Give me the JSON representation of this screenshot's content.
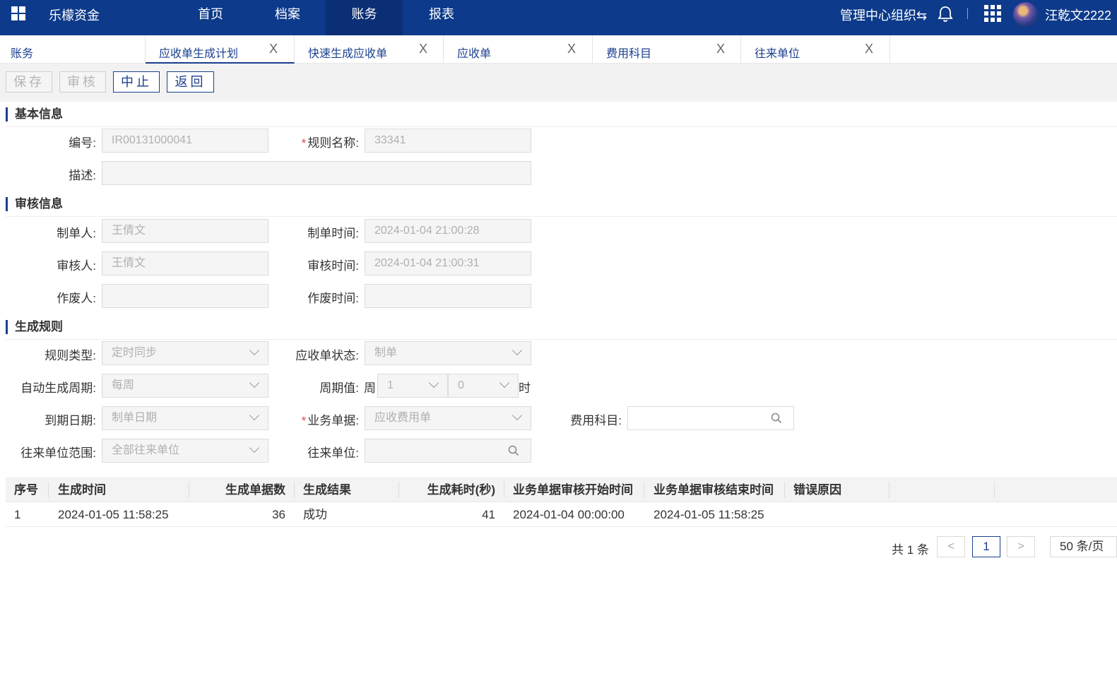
{
  "topbar": {
    "app_name": "乐檬资金",
    "nav": [
      "首页",
      "档案",
      "账务",
      "报表"
    ],
    "active_nav": "账务",
    "org": "管理中心组织",
    "org_switch_icon": "⇆",
    "user": "汪乾文2222"
  },
  "tabs": {
    "home": "账务",
    "items": [
      "应收单生成计划",
      "快速生成应收单",
      "应收单",
      "费用科目",
      "往来单位"
    ],
    "close": "X"
  },
  "toolbar": {
    "save": "保存",
    "audit": "审核",
    "stop": "中止",
    "back": "返回"
  },
  "basic": {
    "title": "基本信息",
    "code_label": "编号:",
    "code_value": "IR00131000041",
    "rule_name_label": "规则名称:",
    "rule_name_value": "33341",
    "desc_label": "描述:",
    "desc_value": ""
  },
  "audit": {
    "title": "审核信息",
    "creator_label": "制单人:",
    "creator_value": "王倩文",
    "create_time_label": "制单时间:",
    "create_time_value": "2024-01-04 21:00:28",
    "auditor_label": "审核人:",
    "auditor_value": "王倩文",
    "audit_time_label": "审核时间:",
    "audit_time_value": "2024-01-04 21:00:31",
    "voider_label": "作废人:",
    "voider_value": "",
    "void_time_label": "作废时间:",
    "void_time_value": ""
  },
  "rules": {
    "title": "生成规则",
    "rule_type_label": "规则类型:",
    "rule_type_value": "定时同步",
    "bill_status_label": "应收单状态:",
    "bill_status_value": "制单",
    "cycle_label": "自动生成周期:",
    "cycle_value": "每周",
    "cycle_val_label": "周期值:",
    "week_prefix": "周",
    "week_value": "1",
    "hour_value": "0",
    "hour_suffix": "时",
    "due_label": "到期日期:",
    "due_value": "制单日期",
    "biz_doc_label": "业务单据:",
    "biz_doc_value": "应收费用单",
    "fee_subject_label": "费用科目:",
    "fee_subject_value": "",
    "partner_scope_label": "往来单位范围:",
    "partner_scope_value": "全部往来单位",
    "partner_label": "往来单位:",
    "partner_value": ""
  },
  "table": {
    "columns": [
      "序号",
      "生成时间",
      "生成单据数",
      "生成结果",
      "生成耗时(秒)",
      "业务单据审核开始时间",
      "业务单据审核结束时间",
      "错误原因"
    ],
    "rows": [
      [
        "1",
        "2024-01-05 11:58:25",
        "36",
        "成功",
        "41",
        "2024-01-04 00:00:00",
        "2024-01-05 11:58:25",
        ""
      ]
    ]
  },
  "pager": {
    "total": "共 1 条",
    "prev": "<",
    "current": "1",
    "next": ">",
    "page_size": "50 条/页"
  },
  "colors": {
    "topbar": "#0d3a8a",
    "accent": "#1a3f8f",
    "required": "#e04a4a"
  }
}
